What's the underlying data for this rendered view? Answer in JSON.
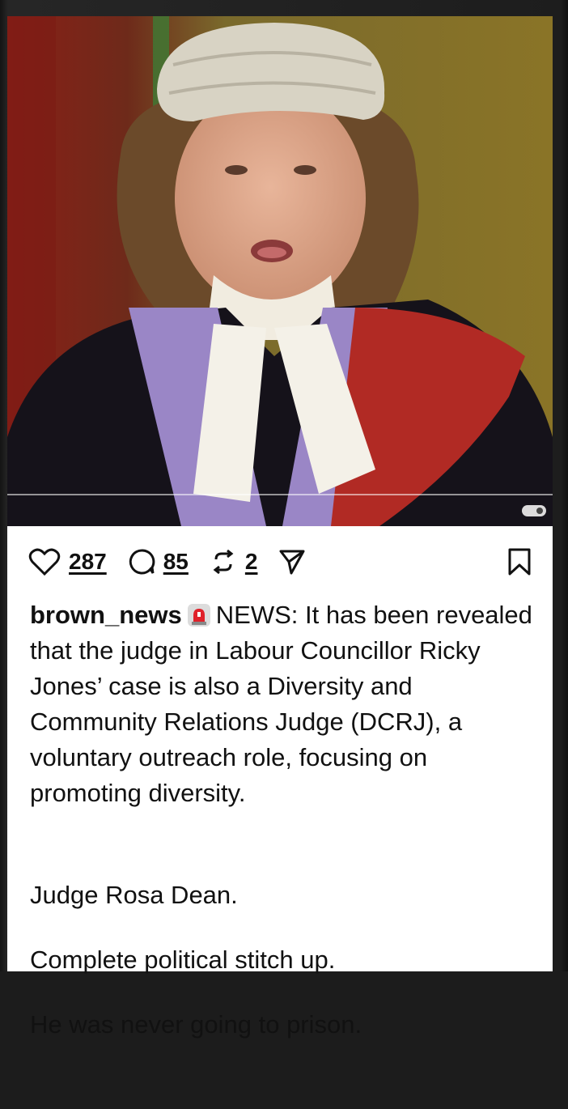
{
  "post": {
    "media": {
      "image_description_icon": "video-progress-icon"
    },
    "actions": {
      "likes": "287",
      "comments": "85",
      "reposts": "2"
    },
    "caption": {
      "username": "brown_news",
      "emoji_icon": "siren-icon",
      "text": "NEWS: It has been revealed that the judge in Labour Councillor Ricky Jones’ case is also a Diversity and Community Relations Judge (DCRJ), a voluntary outreach role, focusing on promoting diversity.",
      "lines": [
        "Judge Rosa Dean.",
        "Complete political stitch up.",
        "He was never going to prison."
      ]
    }
  },
  "colors": {
    "background": "#1c1c1c",
    "card": "#ffffff",
    "text": "#111111",
    "siren": "#e0212a"
  }
}
